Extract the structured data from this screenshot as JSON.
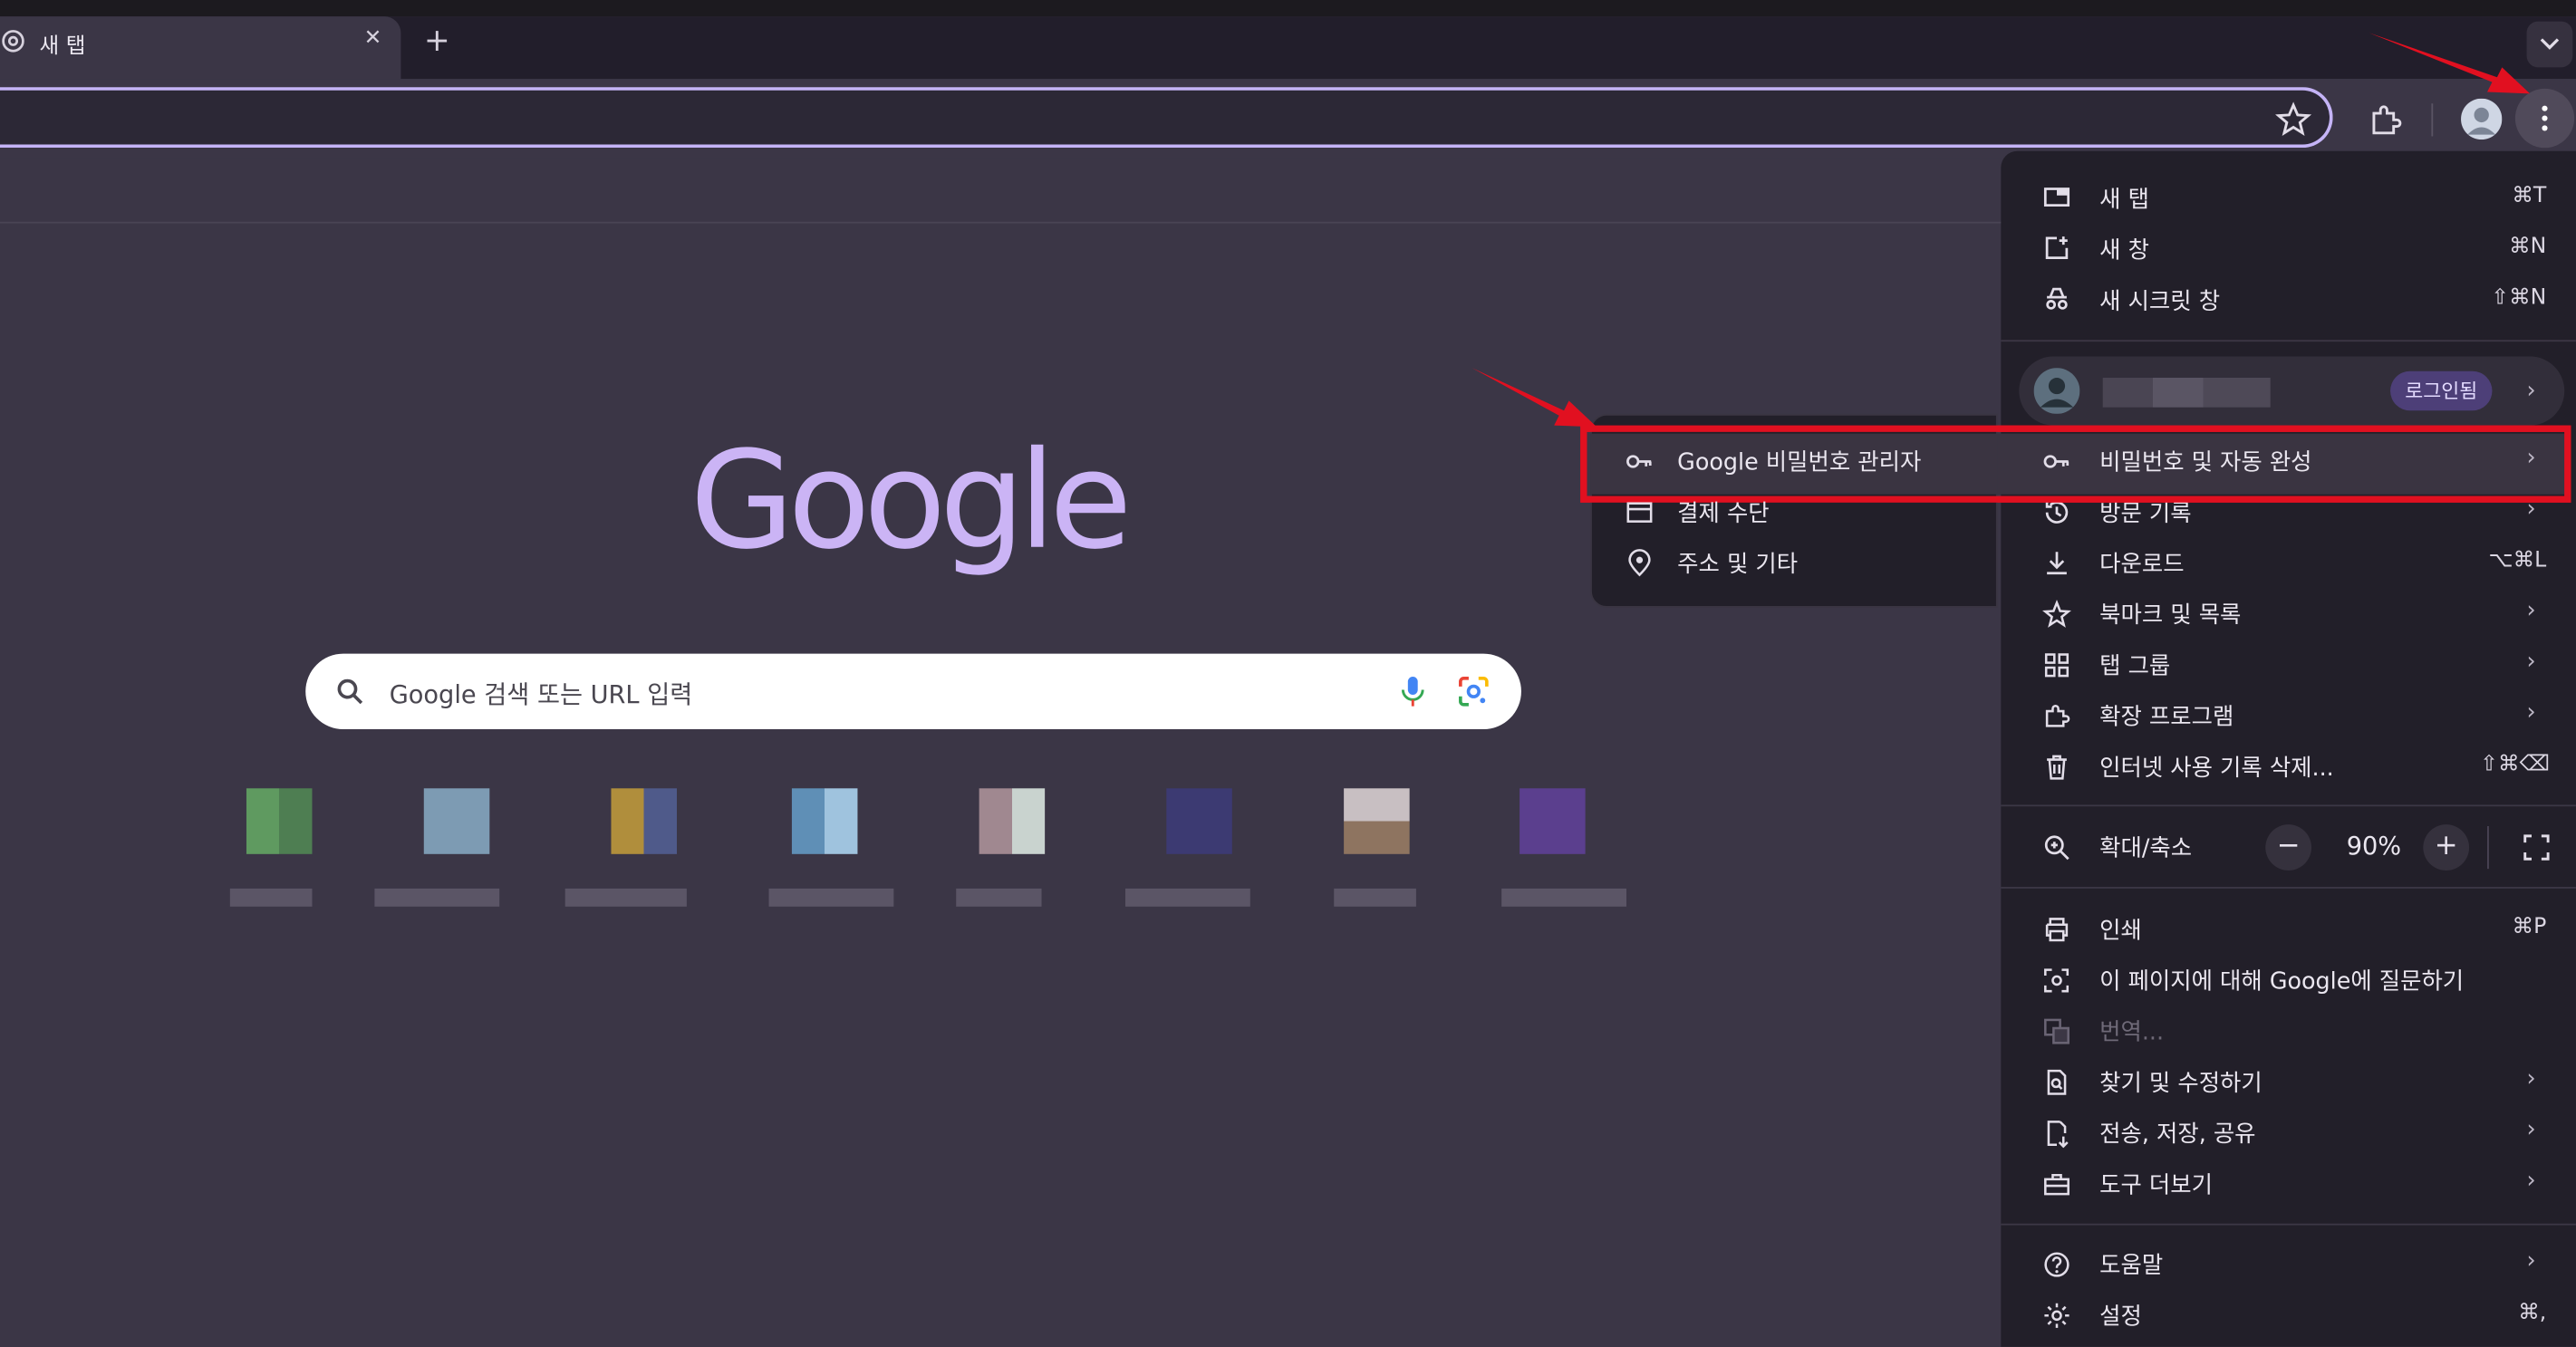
{
  "tab": {
    "title": "새 탭"
  },
  "search": {
    "placeholder": "Google 검색 또는 URL 입력",
    "logo": "Google"
  },
  "menu": {
    "items1": [
      {
        "label": "새 탭",
        "sc": "⌘T"
      },
      {
        "label": "새 창",
        "sc": "⌘N"
      },
      {
        "label": "새 시크릿 창",
        "sc": "⇧⌘N"
      }
    ],
    "profile_badge": "로그인됨",
    "items2": [
      {
        "label": "비밀번호 및 자동 완성",
        "sc": ""
      },
      {
        "label": "방문 기록",
        "sc": ""
      },
      {
        "label": "다운로드",
        "sc": "⌥⌘L"
      },
      {
        "label": "북마크 및 목록",
        "sc": ""
      },
      {
        "label": "탭 그룹",
        "sc": ""
      },
      {
        "label": "확장 프로그램",
        "sc": ""
      },
      {
        "label": "인터넷 사용 기록 삭제...",
        "sc": "⇧⌘⌫"
      }
    ],
    "zoom_label": "확대/축소",
    "zoom_value": "90%",
    "items3": [
      {
        "label": "인쇄",
        "sc": "⌘P"
      },
      {
        "label": "이 페이지에 대해 Google에 질문하기",
        "sc": ""
      },
      {
        "label": "번역...",
        "sc": ""
      },
      {
        "label": "찾기 및 수정하기",
        "sc": ""
      },
      {
        "label": "전송, 저장, 공유",
        "sc": ""
      },
      {
        "label": "도구 더보기",
        "sc": ""
      }
    ],
    "items4": [
      {
        "label": "도움말",
        "sc": ""
      },
      {
        "label": "설정",
        "sc": "⌘,"
      }
    ]
  },
  "submenu": {
    "items": [
      {
        "label": "Google 비밀번호 관리자"
      },
      {
        "label": "결제 수단"
      },
      {
        "label": "주소 및 기타"
      }
    ]
  },
  "colors": {
    "accent": "#c5b4f7",
    "highlight": "#e11020",
    "page_bg": "#3b3646"
  }
}
